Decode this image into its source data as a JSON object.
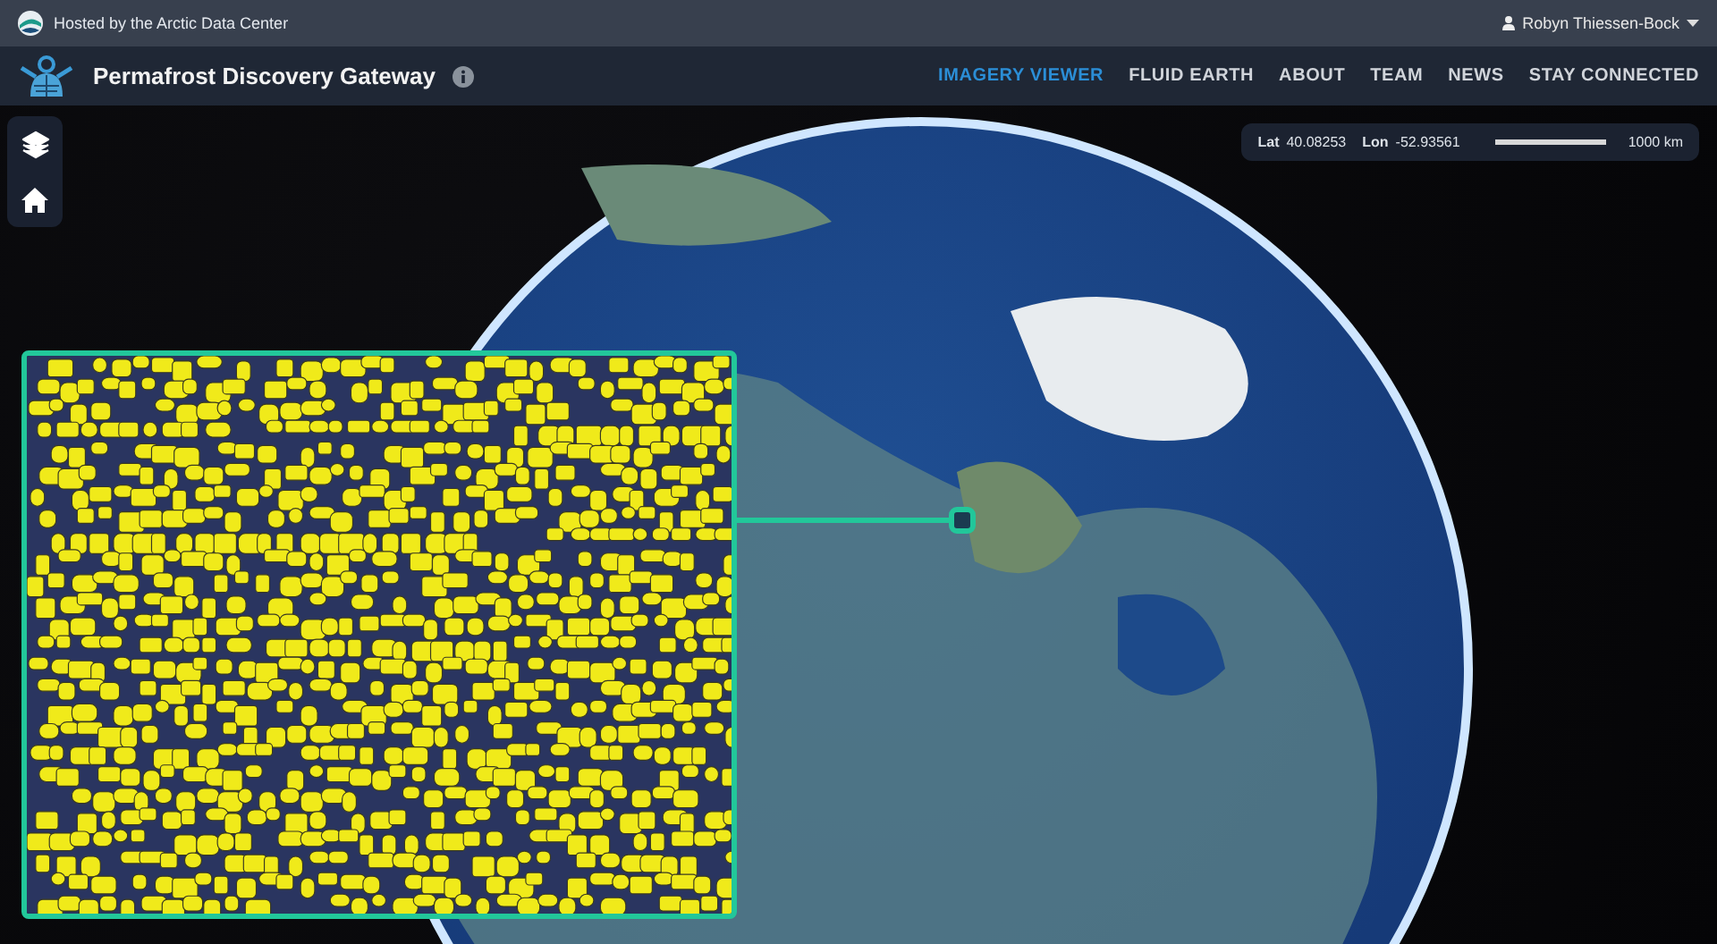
{
  "host_bar": {
    "text": "Hosted by the Arctic Data Center",
    "user": "Robyn Thiessen-Bock"
  },
  "header": {
    "title": "Permafrost Discovery Gateway"
  },
  "nav": [
    {
      "label": "IMAGERY VIEWER",
      "selected": true
    },
    {
      "label": "FLUID EARTH",
      "selected": false
    },
    {
      "label": "ABOUT",
      "selected": false
    },
    {
      "label": "TEAM",
      "selected": false
    },
    {
      "label": "NEWS",
      "selected": false
    },
    {
      "label": "STAY CONNECTED",
      "selected": false
    }
  ],
  "coordinates": {
    "lat_label": "Lat",
    "lat": "40.08253",
    "lon_label": "Lon",
    "lon": "-52.93561",
    "scale": "1000 km"
  }
}
